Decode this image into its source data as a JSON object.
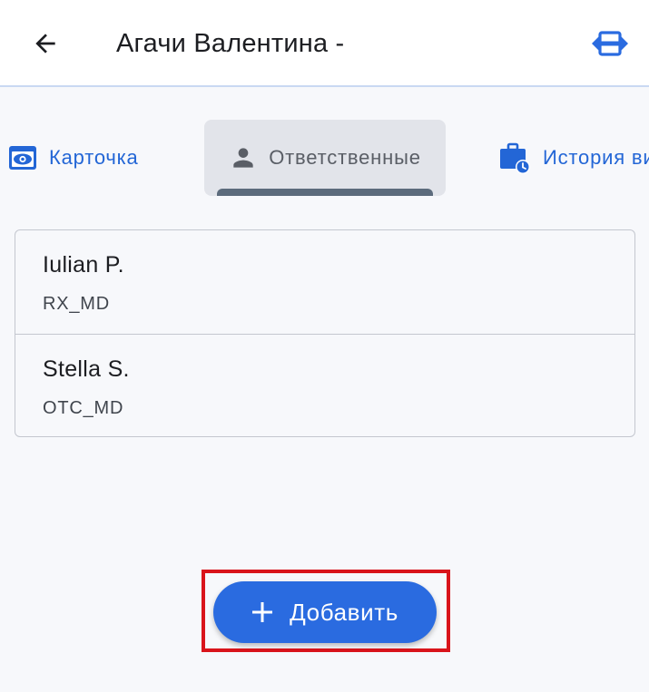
{
  "header": {
    "title": "Агачи Валентина -",
    "back_icon": "arrow-left-icon",
    "switch_icon": "switch-horizontal-icon"
  },
  "tabs": [
    {
      "label": "Карточка",
      "icon": "eye-icon",
      "selected": false
    },
    {
      "label": "Ответственные",
      "icon": "person-icon",
      "selected": true
    },
    {
      "label": "История визитов",
      "icon": "briefcase-clock-icon",
      "selected": false
    }
  ],
  "responsibles": [
    {
      "name": "Iulian P.",
      "code": "RX_MD"
    },
    {
      "name": "Stella S.",
      "code": "OTC_MD"
    }
  ],
  "add_button": {
    "label": "Добавить",
    "icon": "plus-icon"
  },
  "colors": {
    "accent": "#2a6be0",
    "tab_link": "#2366d6",
    "selected_tab_bg": "#e2e4ea",
    "indicator": "#5c6b7c",
    "highlight": "#d9141b"
  }
}
